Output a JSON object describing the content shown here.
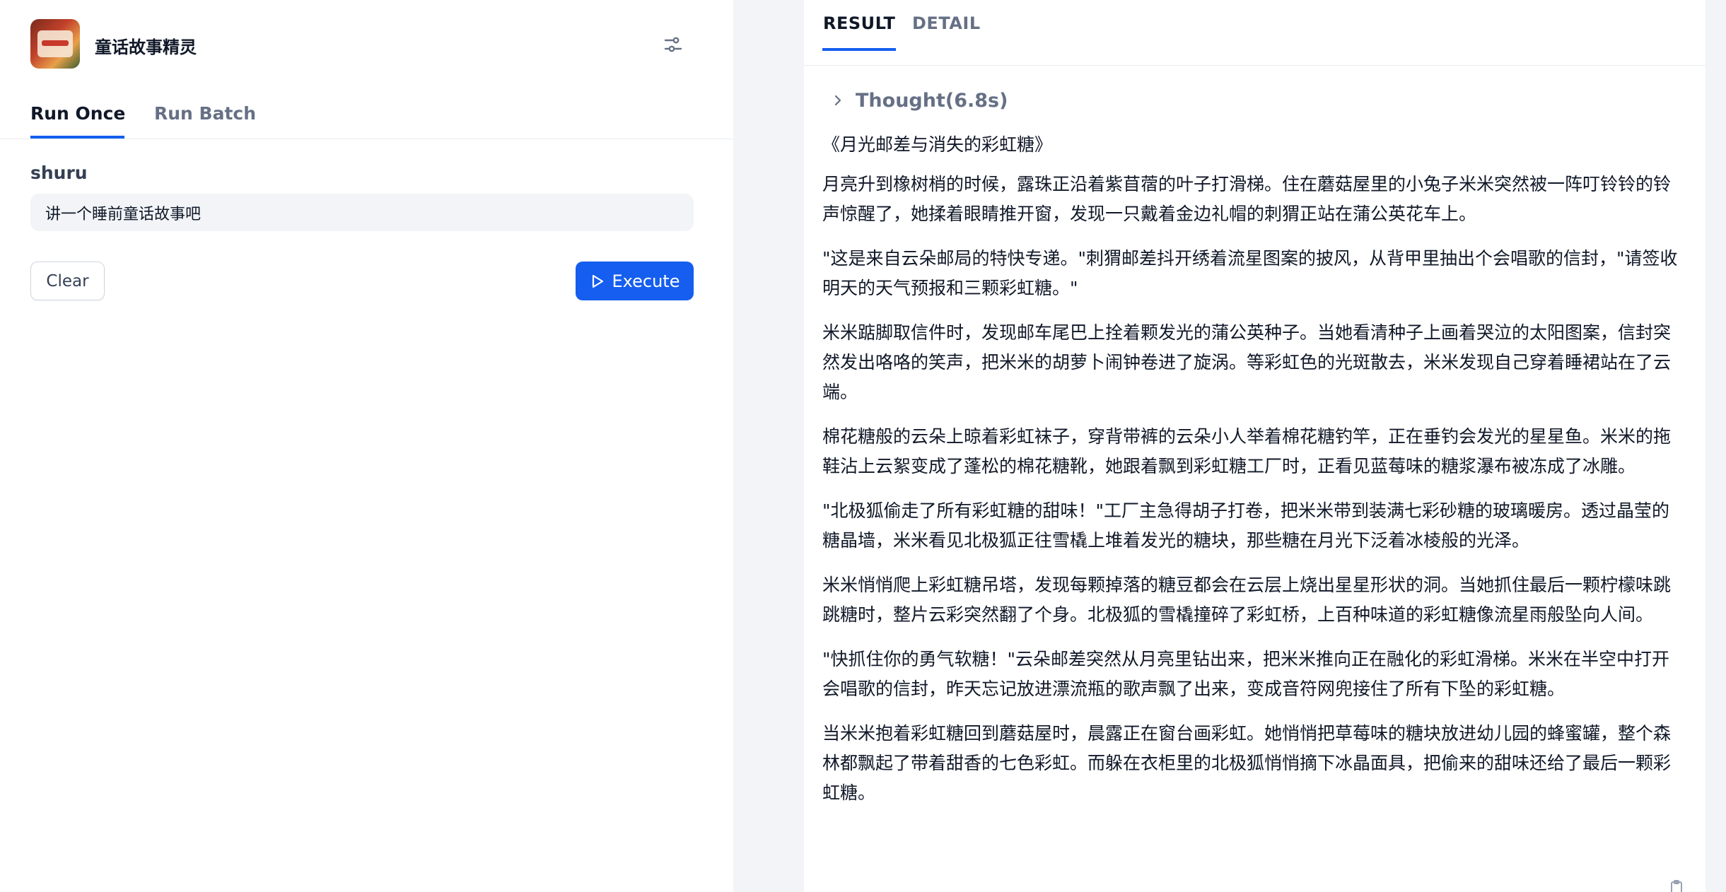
{
  "app": {
    "name": "童话故事精灵",
    "logo_icon": "storybook-logo-icon"
  },
  "mode_tabs": {
    "run_once": "Run Once",
    "run_batch": "Run Batch",
    "active": "run_once"
  },
  "form": {
    "field_label": "shuru",
    "field_value": "讲一个睡前童话故事吧",
    "clear_label": "Clear",
    "execute_label": "Execute"
  },
  "result_tabs": {
    "result": "RESULT",
    "detail": "DETAIL",
    "active": "result"
  },
  "thought": {
    "label": "Thought(6.8s)"
  },
  "story": {
    "title": "《月光邮差与消失的彩虹糖》",
    "paragraphs": [
      "月亮升到橡树梢的时候，露珠正沿着紫苜蓿的叶子打滑梯。住在蘑菇屋里的小兔子米米突然被一阵叮铃铃的铃声惊醒了，她揉着眼睛推开窗，发现一只戴着金边礼帽的刺猬正站在蒲公英花车上。",
      "\"这是来自云朵邮局的特快专递。\"刺猬邮差抖开绣着流星图案的披风，从背甲里抽出个会唱歌的信封，\"请签收明天的天气预报和三颗彩虹糖。\"",
      "米米踮脚取信件时，发现邮车尾巴上拴着颗发光的蒲公英种子。当她看清种子上画着哭泣的太阳图案，信封突然发出咯咯的笑声，把米米的胡萝卜闹钟卷进了旋涡。等彩虹色的光斑散去，米米发现自己穿着睡裙站在了云端。",
      "棉花糖般的云朵上晾着彩虹袜子，穿背带裤的云朵小人举着棉花糖钓竿，正在垂钓会发光的星星鱼。米米的拖鞋沾上云絮变成了蓬松的棉花糖靴，她跟着飘到彩虹糖工厂时，正看见蓝莓味的糖浆瀑布被冻成了冰雕。",
      "\"北极狐偷走了所有彩虹糖的甜味！\"工厂主急得胡子打卷，把米米带到装满七彩砂糖的玻璃暖房。透过晶莹的糖晶墙，米米看见北极狐正往雪橇上堆着发光的糖块，那些糖在月光下泛着冰棱般的光泽。",
      "米米悄悄爬上彩虹糖吊塔，发现每颗掉落的糖豆都会在云层上烧出星星形状的洞。当她抓住最后一颗柠檬味跳跳糖时，整片云彩突然翻了个身。北极狐的雪橇撞碎了彩虹桥，上百种味道的彩虹糖像流星雨般坠向人间。",
      "\"快抓住你的勇气软糖！\"云朵邮差突然从月亮里钻出来，把米米推向正在融化的彩虹滑梯。米米在半空中打开会唱歌的信封，昨天忘记放进漂流瓶的歌声飘了出来，变成音符网兜接住了所有下坠的彩虹糖。",
      "当米米抱着彩虹糖回到蘑菇屋时，晨露正在窗台画彩虹。她悄悄把草莓味的糖块放进幼儿园的蜂蜜罐，整个森林都飘起了带着甜香的七色彩虹。而躲在衣柜里的北极狐悄悄摘下冰晶面具，把偷来的甜味还给了最后一颗彩虹糖。"
    ]
  },
  "colors": {
    "primary": "#155eef",
    "right_bg": "#f2f4f7",
    "muted_text": "#667085"
  },
  "icons": {
    "settings": "sliders-settings-icon",
    "execute": "play-icon",
    "thought_toggle": "chevron-right-icon",
    "copy": "clipboard-icon"
  }
}
